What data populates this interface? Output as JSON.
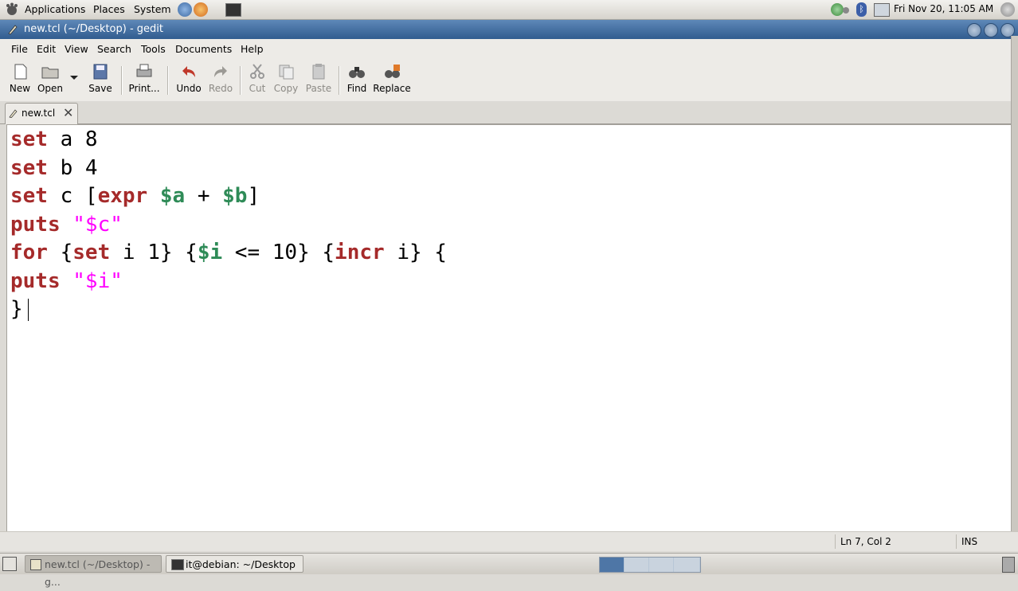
{
  "top_panel": {
    "menus": [
      "Applications",
      "Places",
      "System"
    ],
    "clock": "Fri Nov 20, 11:05 AM"
  },
  "window": {
    "title": "new.tcl (~/Desktop) - gedit"
  },
  "menubar": [
    "File",
    "Edit",
    "View",
    "Search",
    "Tools",
    "Documents",
    "Help"
  ],
  "toolbar": {
    "new": "New",
    "open": "Open",
    "save": "Save",
    "print": "Print...",
    "undo": "Undo",
    "redo": "Redo",
    "cut": "Cut",
    "copy": "Copy",
    "paste": "Paste",
    "find": "Find",
    "replace": "Replace"
  },
  "tab": {
    "label": "new.tcl"
  },
  "editor": {
    "lines": [
      "set a 8",
      "set b 4",
      "set c [expr $a + $b]",
      "puts \"$c\"",
      "for {set i 1} {$i <= 10} {incr i} {",
      "puts \"$i\"",
      "}"
    ]
  },
  "statusbar": {
    "position": "Ln 7, Col 2",
    "mode": "INS"
  },
  "taskbar": {
    "tasks": [
      "new.tcl (~/Desktop) - g...",
      "it@debian: ~/Desktop"
    ]
  },
  "colors": {
    "keyword": "#a52a2a",
    "variable": "#2e8b57",
    "string": "#ff00ff",
    "titlebar": "#3f6a9c"
  }
}
